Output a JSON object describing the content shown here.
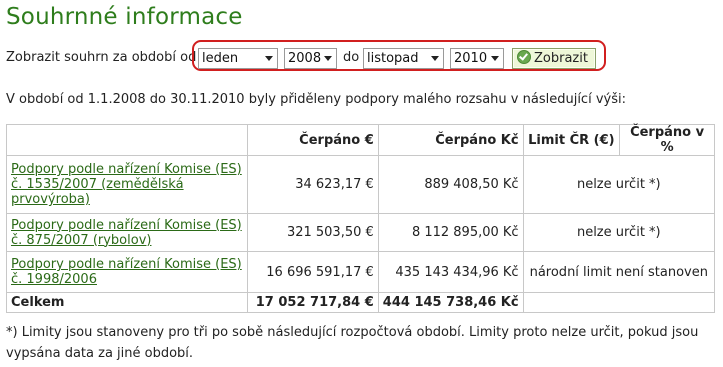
{
  "page": {
    "title": "Souhrnné informace"
  },
  "filter": {
    "label": "Zobrazit souhrn za období od",
    "from_month": "leden",
    "from_year": "2008",
    "to_label": "do",
    "to_month": "listopad",
    "to_year": "2010",
    "submit_label": "Zobrazit",
    "highlight_color": "#d11f1f"
  },
  "intro": "V období od 1.1.2008 do 30.11.2010 byly přiděleny podpory malého rozsahu v následující výši:",
  "table": {
    "headers": [
      "",
      "Čerpáno €",
      "Čerpáno Kč",
      "Limit ČR (€)",
      "Čerpáno v %"
    ],
    "rows": [
      {
        "name": "Podpory podle nařízení Komise (ES) č. 1535/2007 (zemědělská prvovýroba)",
        "eur": "34 623,17 €",
        "czk": "889 408,50 Kč",
        "limit": "nelze určit *)"
      },
      {
        "name": "Podpory podle nařízení Komise (ES) č. 875/2007 (rybolov)",
        "eur": "321 503,50 €",
        "czk": "8 112 895,00 Kč",
        "limit": "nelze určit *)"
      },
      {
        "name": "Podpory podle nařízení Komise (ES) č. 1998/2006",
        "eur": "16 696 591,17 €",
        "czk": "435 143 434,96 Kč",
        "limit": "národní limit není stanoven"
      }
    ],
    "total": {
      "label": "Celkem",
      "eur": "17 052 717,84 €",
      "czk": "444 145 738,46 Kč"
    }
  },
  "note": "*) Limity jsou stanoveny pro tři po sobě následující rozpočtová období. Limity proto nelze určit, pokud jsou vypsána data za jiné období.",
  "colors": {
    "heading": "#2e7d1c",
    "link": "#2b6a17",
    "button_bg": "#eef7d8"
  }
}
